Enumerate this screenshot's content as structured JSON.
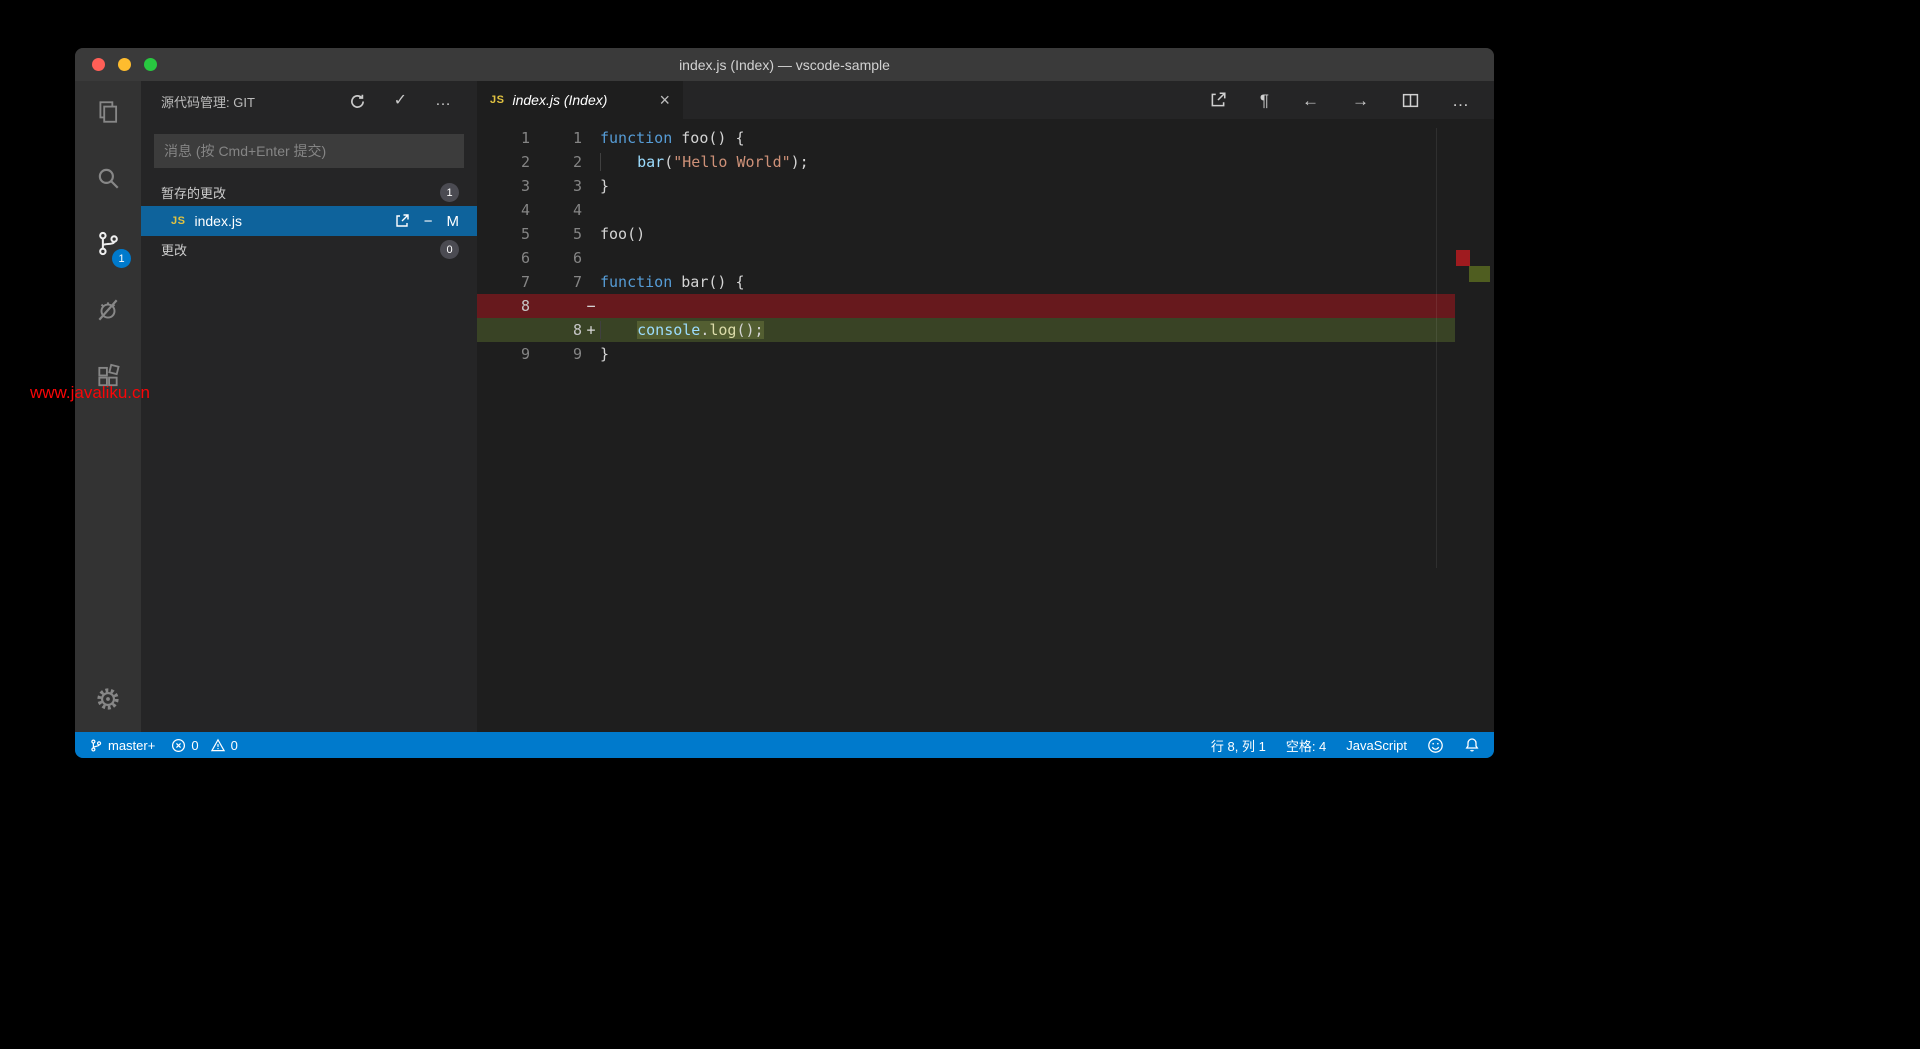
{
  "titlebar": {
    "title": "index.js (Index) — vscode-sample"
  },
  "activity_bar": {
    "scm_badge": "1"
  },
  "sidebar": {
    "title": "源代码管理: GIT",
    "commit_placeholder": "消息 (按 Cmd+Enter 提交)",
    "staged_section": {
      "label": "暂存的更改",
      "badge": "1"
    },
    "changes_section": {
      "label": "更改",
      "badge": "0"
    },
    "file": {
      "icon": "JS",
      "name": "index.js",
      "status": "M"
    }
  },
  "editor": {
    "tab": {
      "icon": "JS",
      "label": "index.js (Index)"
    }
  },
  "icons": {
    "check": "✓",
    "more": "…",
    "minus": "−",
    "plus": "+",
    "pilcrow": "¶",
    "arrow_left": "←",
    "arrow_right": "→",
    "close": "×"
  },
  "code": {
    "lines": [
      {
        "old": "1",
        "new": "1",
        "type": "ctx",
        "tokens": [
          [
            "kw",
            "function"
          ],
          [
            "plain",
            " foo() {"
          ]
        ]
      },
      {
        "old": "2",
        "new": "2",
        "type": "ctx",
        "indent": 1,
        "tokens": [
          [
            "var",
            "bar"
          ],
          [
            "plain",
            "("
          ],
          [
            "str",
            "\"Hello World\""
          ],
          [
            "plain",
            ");"
          ]
        ]
      },
      {
        "old": "3",
        "new": "3",
        "type": "ctx",
        "tokens": [
          [
            "plain",
            "}"
          ]
        ]
      },
      {
        "old": "4",
        "new": "4",
        "type": "ctx",
        "tokens": []
      },
      {
        "old": "5",
        "new": "5",
        "type": "ctx",
        "tokens": [
          [
            "plain",
            "foo()"
          ]
        ]
      },
      {
        "old": "6",
        "new": "6",
        "type": "ctx",
        "tokens": []
      },
      {
        "old": "7",
        "new": "7",
        "type": "ctx",
        "tokens": [
          [
            "kw",
            "function"
          ],
          [
            "plain",
            " bar() {"
          ]
        ]
      },
      {
        "old": "8",
        "new": "",
        "type": "removed",
        "tokens": []
      },
      {
        "old": "",
        "new": "8",
        "type": "added",
        "indent": 1,
        "tokens": [
          [
            "var",
            "console"
          ],
          [
            "plain",
            "."
          ],
          [
            "fn",
            "log"
          ],
          [
            "plain",
            "();"
          ]
        ]
      },
      {
        "old": "9",
        "new": "9",
        "type": "ctx",
        "tokens": [
          [
            "plain",
            "}"
          ]
        ]
      }
    ]
  },
  "status_bar": {
    "branch": "master+",
    "errors": "0",
    "warnings": "0",
    "cursor": "行 8, 列 1",
    "indent": "空格: 4",
    "language": "JavaScript"
  },
  "watermark": "www.javaliku.cn",
  "colors": {
    "status_bar": "#007acc",
    "selection": "#0e639c",
    "removed_line_bg": "#67191d",
    "added_line_bg": "#394325",
    "traffic_red": "#ff5f57",
    "traffic_yellow": "#febc2e",
    "traffic_green": "#28c840",
    "js_icon": "#e2c341",
    "watermark": "#fa0507",
    "syntax": {
      "keyword": "#569cd6",
      "string": "#ce9178",
      "function": "#dcdcaa",
      "variable": "#9cdcfe",
      "text": "#d4d4d4"
    }
  }
}
